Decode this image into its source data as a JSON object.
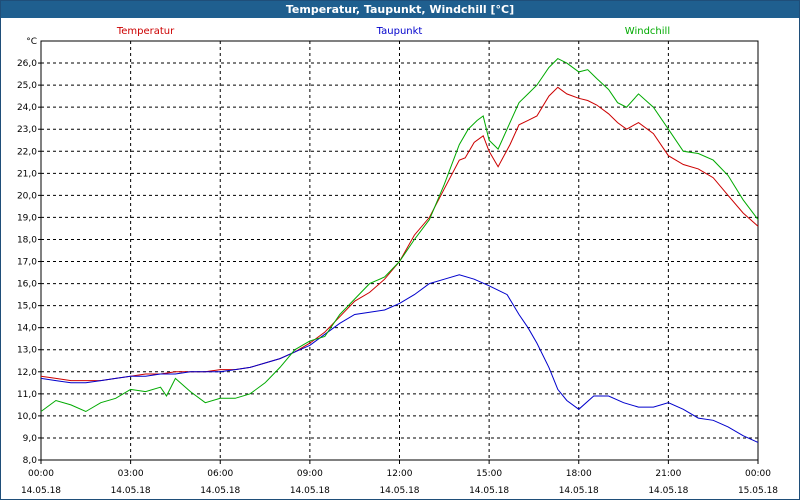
{
  "window": {
    "title": "Temperatur, Taupunkt, Windchill [°C]"
  },
  "chart_data": {
    "type": "line",
    "title": "Temperatur, Taupunkt, Windchill [°C]",
    "ylabel": "°C",
    "ylim": [
      8.0,
      27.0
    ],
    "y_ticks": [
      "8,0",
      "9,0",
      "10,0",
      "11,0",
      "12,0",
      "13,0",
      "14,0",
      "15,0",
      "16,0",
      "17,0",
      "18,0",
      "19,0",
      "20,0",
      "21,0",
      "22,0",
      "23,0",
      "24,0",
      "25,0",
      "26,0"
    ],
    "xlim": [
      0,
      24
    ],
    "x_ticks": [
      {
        "time": "00:00",
        "date": "14.05.18"
      },
      {
        "time": "03:00",
        "date": "14.05.18"
      },
      {
        "time": "06:00",
        "date": "14.05.18"
      },
      {
        "time": "09:00",
        "date": "14.05.18"
      },
      {
        "time": "12:00",
        "date": "14.05.18"
      },
      {
        "time": "15:00",
        "date": "14.05.18"
      },
      {
        "time": "18:00",
        "date": "14.05.18"
      },
      {
        "time": "21:00",
        "date": "14.05.18"
      },
      {
        "time": "00:00",
        "date": "15.05.18"
      }
    ],
    "grid": true,
    "series": [
      {
        "name": "Temperatur",
        "color": "#cc0000",
        "x": [
          0,
          0.5,
          1,
          1.5,
          2,
          2.5,
          3,
          3.5,
          4,
          4.5,
          5,
          5.5,
          6,
          6.5,
          7,
          7.5,
          8,
          8.5,
          9,
          9.5,
          10,
          10.5,
          11,
          11.5,
          12,
          12.5,
          13,
          13.5,
          14,
          14.2,
          14.5,
          14.8,
          15,
          15.3,
          15.7,
          16,
          16.3,
          16.6,
          17,
          17.3,
          17.6,
          18,
          18.3,
          18.6,
          19,
          19.3,
          19.6,
          20,
          20.5,
          21,
          21.5,
          22,
          22.5,
          23,
          23.5,
          24
        ],
        "y": [
          11.8,
          11.7,
          11.6,
          11.6,
          11.6,
          11.7,
          11.8,
          11.9,
          11.9,
          12.0,
          12.0,
          12.0,
          12.1,
          12.1,
          12.2,
          12.4,
          12.6,
          12.9,
          13.3,
          13.8,
          14.5,
          15.2,
          15.6,
          16.2,
          17.0,
          18.2,
          19.0,
          20.3,
          21.6,
          21.7,
          22.4,
          22.7,
          22.0,
          21.3,
          22.3,
          23.2,
          23.4,
          23.6,
          24.5,
          24.9,
          24.6,
          24.4,
          24.3,
          24.1,
          23.7,
          23.3,
          23.0,
          23.3,
          22.8,
          21.8,
          21.4,
          21.2,
          20.8,
          20.0,
          19.2,
          18.6
        ]
      },
      {
        "name": "Taupunkt",
        "color": "#0000cc",
        "x": [
          0,
          0.5,
          1,
          1.5,
          2,
          2.5,
          3,
          3.5,
          4,
          4.5,
          5,
          5.5,
          6,
          6.5,
          7,
          7.5,
          8,
          8.5,
          9,
          9.5,
          10,
          10.5,
          11,
          11.5,
          12,
          12.5,
          13,
          13.5,
          14,
          14.5,
          15,
          15.3,
          15.6,
          16,
          16.3,
          16.6,
          17,
          17.3,
          17.6,
          18,
          18.5,
          19,
          19.5,
          20,
          20.5,
          21,
          21.5,
          22,
          22.5,
          23,
          23.5,
          24
        ],
        "y": [
          11.7,
          11.6,
          11.5,
          11.5,
          11.6,
          11.7,
          11.8,
          11.8,
          11.9,
          11.9,
          12.0,
          12.0,
          12.0,
          12.1,
          12.2,
          12.4,
          12.6,
          12.9,
          13.2,
          13.7,
          14.2,
          14.6,
          14.7,
          14.8,
          15.1,
          15.5,
          16.0,
          16.2,
          16.4,
          16.2,
          15.9,
          15.7,
          15.5,
          14.6,
          14.0,
          13.3,
          12.2,
          11.2,
          10.7,
          10.3,
          10.9,
          10.9,
          10.6,
          10.4,
          10.4,
          10.6,
          10.3,
          9.9,
          9.8,
          9.5,
          9.1,
          8.8
        ]
      },
      {
        "name": "Windchill",
        "color": "#00aa00",
        "x": [
          0,
          0.5,
          1,
          1.5,
          2,
          2.5,
          3,
          3.5,
          4,
          4.2,
          4.5,
          5,
          5.5,
          6,
          6.5,
          7,
          7.5,
          8,
          8.5,
          9,
          9.5,
          10,
          10.5,
          11,
          11.5,
          12,
          12.5,
          13,
          13.5,
          14,
          14.3,
          14.6,
          14.8,
          15,
          15.3,
          15.7,
          16,
          16.3,
          16.6,
          17,
          17.3,
          17.6,
          18,
          18.3,
          18.6,
          19,
          19.3,
          19.6,
          20,
          20.5,
          21,
          21.5,
          22,
          22.5,
          23,
          23.5,
          24
        ],
        "y": [
          10.2,
          10.7,
          10.5,
          10.2,
          10.6,
          10.8,
          11.2,
          11.1,
          11.3,
          10.9,
          11.7,
          11.1,
          10.6,
          10.8,
          10.8,
          11.0,
          11.5,
          12.2,
          13.0,
          13.4,
          13.6,
          14.6,
          15.3,
          16.0,
          16.3,
          17.0,
          18.0,
          18.9,
          20.5,
          22.3,
          23.0,
          23.4,
          23.6,
          22.5,
          22.1,
          23.3,
          24.2,
          24.6,
          25.0,
          25.8,
          26.2,
          26.0,
          25.6,
          25.7,
          25.3,
          24.8,
          24.2,
          24.0,
          24.6,
          24.0,
          23.0,
          22.0,
          21.9,
          21.6,
          20.9,
          19.8,
          18.9
        ]
      }
    ]
  }
}
